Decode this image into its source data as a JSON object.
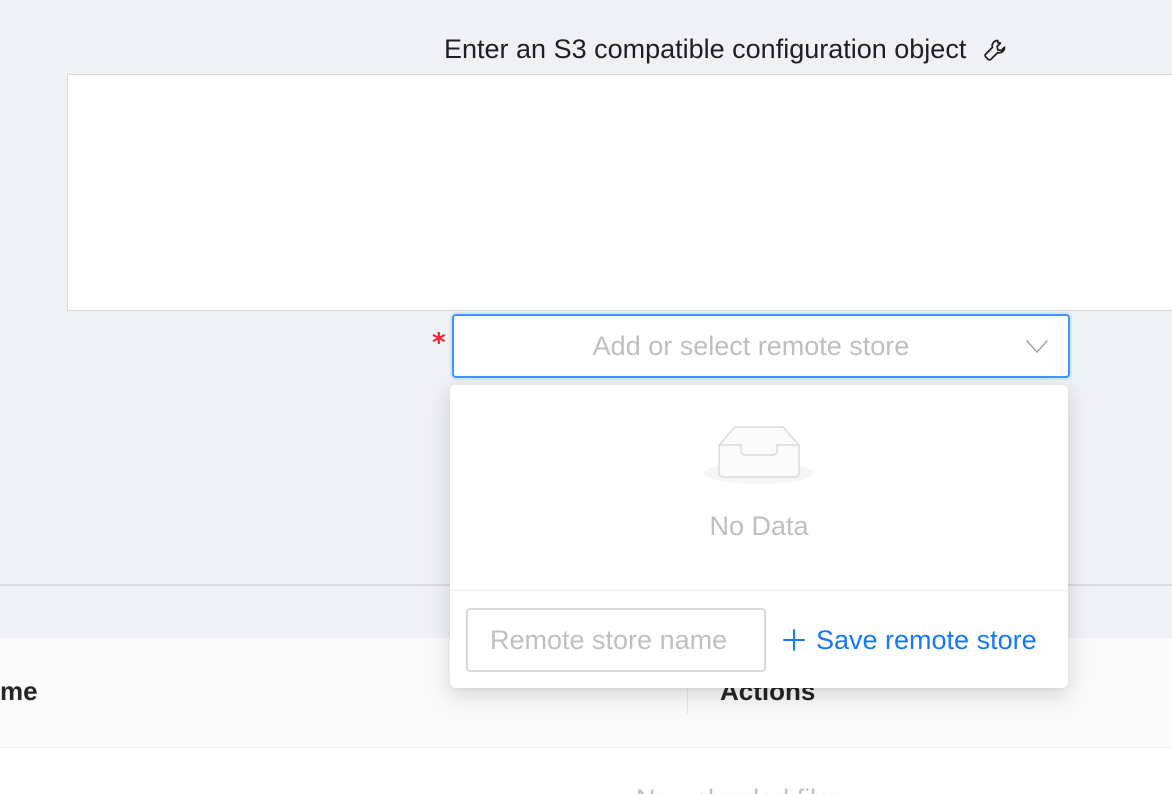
{
  "config": {
    "label": "Enter an S3 compatible configuration object",
    "label_icon": "wrench-icon",
    "textarea_value": ""
  },
  "remote_store_select": {
    "required": true,
    "placeholder": "Add or select remote store",
    "chevron_icon": "chevron-down-icon",
    "dropdown": {
      "empty_icon": "empty-inbox-icon",
      "empty_text": "No Data",
      "name_input": {
        "value": "",
        "placeholder": "Remote store name"
      },
      "save_label": "Save remote store",
      "save_icon": "plus-icon"
    }
  },
  "table": {
    "columns": [
      "me",
      "Actions"
    ],
    "empty_text_partial": "No uploaded files"
  },
  "colors": {
    "accent": "#1677ff",
    "required": "#f5222d",
    "placeholder": "#bfbfbf",
    "focus_border": "#4096ff"
  }
}
